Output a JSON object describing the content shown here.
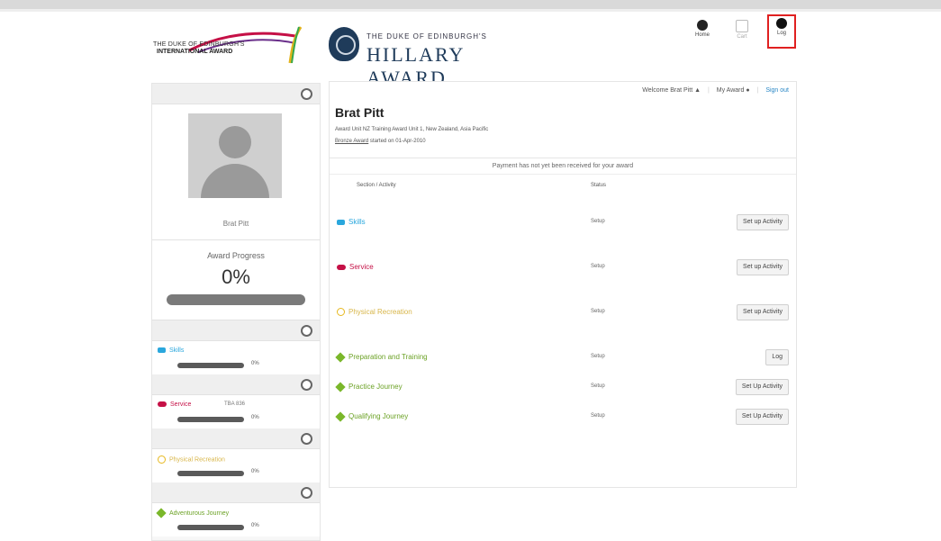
{
  "header": {
    "left_logo_line1": "THE DUKE OF EDINBURGH'S",
    "left_logo_line2": "INTERNATIONAL AWARD",
    "right_logo_line1": "THE DUKE OF EDINBURGH'S",
    "right_logo_line2": "HILLARY AWARD",
    "nav": {
      "home": "Home",
      "cart": "Cart",
      "log": "Log"
    }
  },
  "sidebar": {
    "name": "Brat Pitt",
    "progress_label": "Award Progress",
    "progress_value": "0%",
    "sections": [
      {
        "label": "Skills",
        "pct": "0%",
        "extra": ""
      },
      {
        "label": "Service",
        "pct": "0%",
        "extra": "TBA 836"
      },
      {
        "label": "Physical Recreation",
        "pct": "0%",
        "extra": ""
      },
      {
        "label": "Adventurous Journey",
        "pct": "0%",
        "extra": ""
      }
    ]
  },
  "main": {
    "welcome": "Welcome Brat Pitt",
    "my_award": "My Award",
    "sign_out": "Sign out",
    "name": "Brat Pitt",
    "line1": "Award Unit NZ Training Award Unit 1, New Zealand, Asia Pacific",
    "line2_link": "Bronze Award",
    "line2_rest": "started on 01-Apr-2010",
    "payment": "Payment has not yet been received for your award",
    "col_section": "Section / Activity",
    "col_status": "Status",
    "rows": [
      {
        "activity": "Skills",
        "status": "Setup",
        "button": "Set up Activity"
      },
      {
        "activity": "Service",
        "status": "Setup",
        "button": "Set up Activity"
      },
      {
        "activity": "Physical Recreation",
        "status": "Setup",
        "button": "Set up Activity"
      },
      {
        "activity": "Preparation and Training",
        "status": "Setup",
        "button": "Log"
      },
      {
        "activity": "Practice Journey",
        "status": "Setup",
        "button": "Set Up Activity"
      },
      {
        "activity": "Qualifying Journey",
        "status": "Setup",
        "button": "Set Up Activity"
      }
    ]
  },
  "colors": {
    "skills": "#2aa7dd",
    "service": "#c51046",
    "physical": "#d8b64a",
    "adventurous": "#6ca226",
    "highlight": "#e02020"
  }
}
